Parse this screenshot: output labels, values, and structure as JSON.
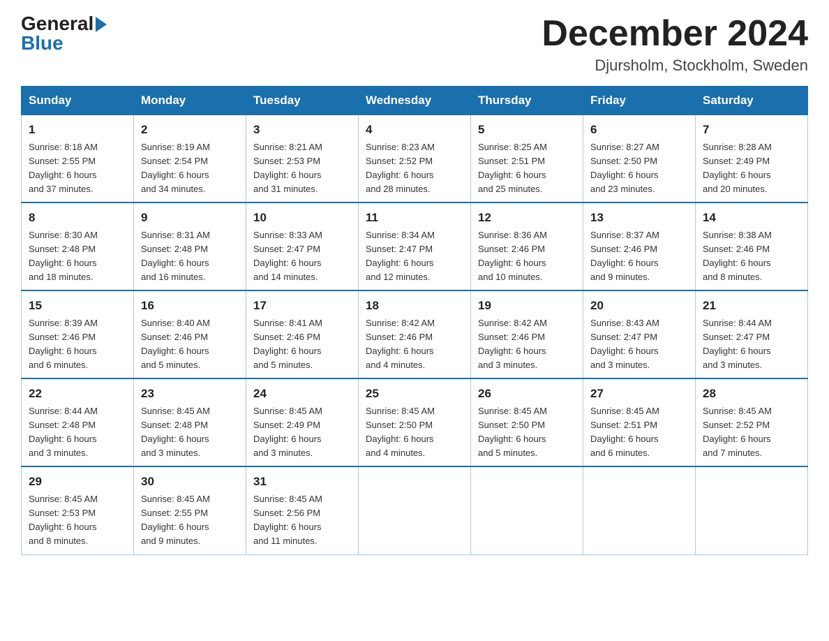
{
  "header": {
    "logo_general": "General",
    "logo_blue": "Blue",
    "month_title": "December 2024",
    "location": "Djursholm, Stockholm, Sweden"
  },
  "weekdays": [
    "Sunday",
    "Monday",
    "Tuesday",
    "Wednesday",
    "Thursday",
    "Friday",
    "Saturday"
  ],
  "weeks": [
    [
      {
        "day": "1",
        "sunrise": "8:18 AM",
        "sunset": "2:55 PM",
        "daylight": "6 hours and 37 minutes."
      },
      {
        "day": "2",
        "sunrise": "8:19 AM",
        "sunset": "2:54 PM",
        "daylight": "6 hours and 34 minutes."
      },
      {
        "day": "3",
        "sunrise": "8:21 AM",
        "sunset": "2:53 PM",
        "daylight": "6 hours and 31 minutes."
      },
      {
        "day": "4",
        "sunrise": "8:23 AM",
        "sunset": "2:52 PM",
        "daylight": "6 hours and 28 minutes."
      },
      {
        "day": "5",
        "sunrise": "8:25 AM",
        "sunset": "2:51 PM",
        "daylight": "6 hours and 25 minutes."
      },
      {
        "day": "6",
        "sunrise": "8:27 AM",
        "sunset": "2:50 PM",
        "daylight": "6 hours and 23 minutes."
      },
      {
        "day": "7",
        "sunrise": "8:28 AM",
        "sunset": "2:49 PM",
        "daylight": "6 hours and 20 minutes."
      }
    ],
    [
      {
        "day": "8",
        "sunrise": "8:30 AM",
        "sunset": "2:48 PM",
        "daylight": "6 hours and 18 minutes."
      },
      {
        "day": "9",
        "sunrise": "8:31 AM",
        "sunset": "2:48 PM",
        "daylight": "6 hours and 16 minutes."
      },
      {
        "day": "10",
        "sunrise": "8:33 AM",
        "sunset": "2:47 PM",
        "daylight": "6 hours and 14 minutes."
      },
      {
        "day": "11",
        "sunrise": "8:34 AM",
        "sunset": "2:47 PM",
        "daylight": "6 hours and 12 minutes."
      },
      {
        "day": "12",
        "sunrise": "8:36 AM",
        "sunset": "2:46 PM",
        "daylight": "6 hours and 10 minutes."
      },
      {
        "day": "13",
        "sunrise": "8:37 AM",
        "sunset": "2:46 PM",
        "daylight": "6 hours and 9 minutes."
      },
      {
        "day": "14",
        "sunrise": "8:38 AM",
        "sunset": "2:46 PM",
        "daylight": "6 hours and 8 minutes."
      }
    ],
    [
      {
        "day": "15",
        "sunrise": "8:39 AM",
        "sunset": "2:46 PM",
        "daylight": "6 hours and 6 minutes."
      },
      {
        "day": "16",
        "sunrise": "8:40 AM",
        "sunset": "2:46 PM",
        "daylight": "6 hours and 5 minutes."
      },
      {
        "day": "17",
        "sunrise": "8:41 AM",
        "sunset": "2:46 PM",
        "daylight": "6 hours and 5 minutes."
      },
      {
        "day": "18",
        "sunrise": "8:42 AM",
        "sunset": "2:46 PM",
        "daylight": "6 hours and 4 minutes."
      },
      {
        "day": "19",
        "sunrise": "8:42 AM",
        "sunset": "2:46 PM",
        "daylight": "6 hours and 3 minutes."
      },
      {
        "day": "20",
        "sunrise": "8:43 AM",
        "sunset": "2:47 PM",
        "daylight": "6 hours and 3 minutes."
      },
      {
        "day": "21",
        "sunrise": "8:44 AM",
        "sunset": "2:47 PM",
        "daylight": "6 hours and 3 minutes."
      }
    ],
    [
      {
        "day": "22",
        "sunrise": "8:44 AM",
        "sunset": "2:48 PM",
        "daylight": "6 hours and 3 minutes."
      },
      {
        "day": "23",
        "sunrise": "8:45 AM",
        "sunset": "2:48 PM",
        "daylight": "6 hours and 3 minutes."
      },
      {
        "day": "24",
        "sunrise": "8:45 AM",
        "sunset": "2:49 PM",
        "daylight": "6 hours and 3 minutes."
      },
      {
        "day": "25",
        "sunrise": "8:45 AM",
        "sunset": "2:50 PM",
        "daylight": "6 hours and 4 minutes."
      },
      {
        "day": "26",
        "sunrise": "8:45 AM",
        "sunset": "2:50 PM",
        "daylight": "6 hours and 5 minutes."
      },
      {
        "day": "27",
        "sunrise": "8:45 AM",
        "sunset": "2:51 PM",
        "daylight": "6 hours and 6 minutes."
      },
      {
        "day": "28",
        "sunrise": "8:45 AM",
        "sunset": "2:52 PM",
        "daylight": "6 hours and 7 minutes."
      }
    ],
    [
      {
        "day": "29",
        "sunrise": "8:45 AM",
        "sunset": "2:53 PM",
        "daylight": "6 hours and 8 minutes."
      },
      {
        "day": "30",
        "sunrise": "8:45 AM",
        "sunset": "2:55 PM",
        "daylight": "6 hours and 9 minutes."
      },
      {
        "day": "31",
        "sunrise": "8:45 AM",
        "sunset": "2:56 PM",
        "daylight": "6 hours and 11 minutes."
      },
      null,
      null,
      null,
      null
    ]
  ]
}
